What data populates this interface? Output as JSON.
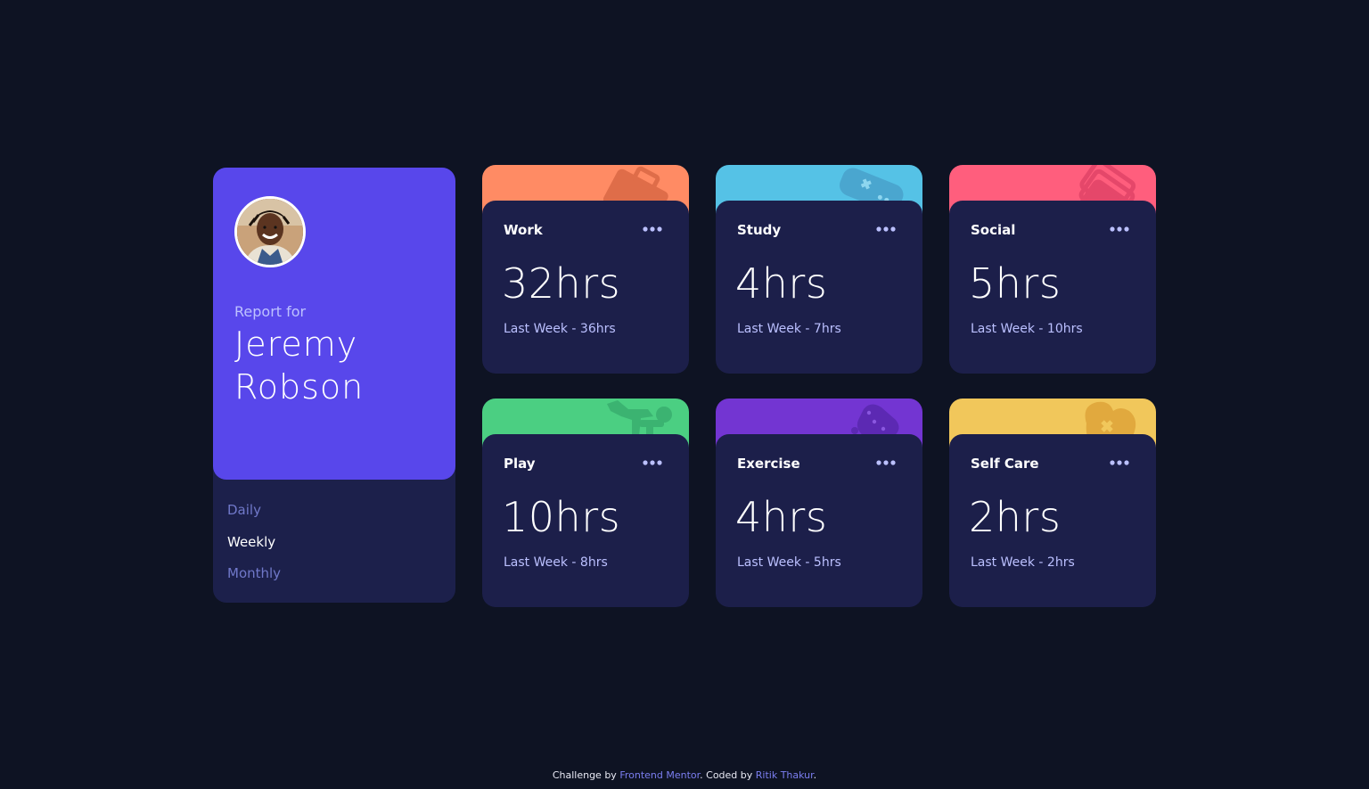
{
  "profile": {
    "report_for": "Report for",
    "name": "Jeremy Robson",
    "periods": [
      {
        "label": "Daily",
        "active": false
      },
      {
        "label": "Weekly",
        "active": true
      },
      {
        "label": "Monthly",
        "active": false
      }
    ]
  },
  "activities": [
    {
      "title": "Work",
      "current": "32hrs",
      "previous": "Last Week - 36hrs",
      "color": "#ff8b64",
      "icon": "briefcase-icon"
    },
    {
      "title": "Study",
      "current": "4hrs",
      "previous": "Last Week - 7hrs",
      "color": "#55c2e6",
      "icon": "gamepad-icon"
    },
    {
      "title": "Social",
      "current": "5hrs",
      "previous": "Last Week - 10hrs",
      "color": "#ff5e7d",
      "icon": "cards-icon"
    },
    {
      "title": "Play",
      "current": "10hrs",
      "previous": "Last Week - 8hrs",
      "color": "#4bcf82",
      "icon": "runner-icon"
    },
    {
      "title": "Exercise",
      "current": "4hrs",
      "previous": "Last Week - 5hrs",
      "color": "#7335d2",
      "icon": "controller-icon"
    },
    {
      "title": "Self Care",
      "current": "2hrs",
      "previous": "Last Week - 2hrs",
      "color": "#f1c75b",
      "icon": "heart-icon"
    }
  ],
  "footer": {
    "prefix": "Challenge by",
    "challenge_link": "Frontend Mentor",
    "middle": ". Coded by",
    "author_link": "Ritik Thakur",
    "suffix": "."
  },
  "colors": {
    "page_bg": "#0e1323",
    "card_bg": "#1c1f4a",
    "profile_accent": "#5847eb"
  }
}
